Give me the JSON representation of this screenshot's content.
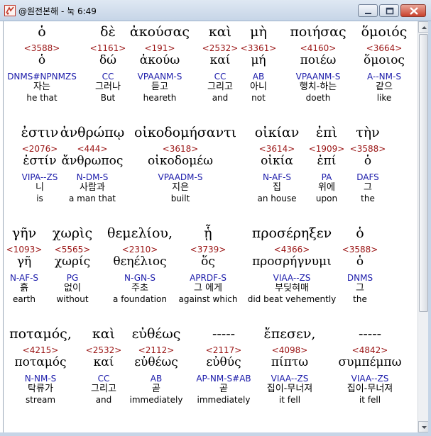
{
  "window": {
    "title": "@원전본해 - 눅 6:49"
  },
  "icons": {
    "app": "app-icon",
    "minimize": "minimize-icon",
    "maximize": "maximize-icon",
    "close": "close-icon"
  },
  "rows": [
    [
      {
        "greek": "ὁ",
        "strong": "<3588>",
        "lemma": "ὁ",
        "parse": "DNMS#NPNMZS",
        "korean": "자는",
        "english": "he that"
      },
      {
        "greek": "δὲ",
        "strong": "<1161>",
        "lemma": "δώ",
        "parse": "CC",
        "korean": "그러나",
        "english": "But"
      },
      {
        "greek": "ἀκούσας",
        "strong": "<191>",
        "lemma": "ἀκούω",
        "parse": "VPAANM-S",
        "korean": "듣고",
        "english": "heareth"
      },
      {
        "greek": "καὶ",
        "strong": "<2532>",
        "lemma": "καί",
        "parse": "CC",
        "korean": "그리고",
        "english": "and"
      },
      {
        "greek": "μὴ",
        "strong": "<3361>",
        "lemma": "μή",
        "parse": "AB",
        "korean": "아니",
        "english": "not"
      },
      {
        "greek": "ποιήσας",
        "strong": "<4160>",
        "lemma": "ποιέω",
        "parse": "VPAANM-S",
        "korean": "행치-하는",
        "english": "doeth"
      },
      {
        "greek": "ὅμοιός",
        "strong": "<3664>",
        "lemma": "ὅμοιος",
        "parse": "A--NM-S",
        "korean": "같으",
        "english": "like"
      }
    ],
    [
      {
        "greek": "ἐστιν",
        "strong": "<2076>",
        "lemma": "ἐστίν",
        "parse": "VIPA--ZS",
        "korean": "니",
        "english": "is"
      },
      {
        "greek": "ἀνθρώπῳ",
        "strong": "<444>",
        "lemma": "ἄνθρωπος",
        "parse": "N-DM-S",
        "korean": "사람과",
        "english": "a man that"
      },
      {
        "greek": "οἰκοδομήσαντι",
        "strong": "<3618>",
        "lemma": "οἰκοδομέω",
        "parse": "VPAADM-S",
        "korean": "지은",
        "english": "built"
      },
      {
        "greek": "οἰκίαν",
        "strong": "<3614>",
        "lemma": "οἰκία",
        "parse": "N-AF-S",
        "korean": "집",
        "english": "an house"
      },
      {
        "greek": "ἐπὶ",
        "strong": "<1909>",
        "lemma": "ἐπί",
        "parse": "PA",
        "korean": "위에",
        "english": "upon"
      },
      {
        "greek": "τὴν",
        "strong": "<3588>",
        "lemma": "ὁ",
        "parse": "DAFS",
        "korean": "그",
        "english": "the"
      }
    ],
    [
      {
        "greek": "γῆν",
        "strong": "<1093>",
        "lemma": "γῆ",
        "parse": "N-AF-S",
        "korean": "흙",
        "english": "earth"
      },
      {
        "greek": "χωρὶς",
        "strong": "<5565>",
        "lemma": "χωρίς",
        "parse": "PG",
        "korean": "없이",
        "english": "without"
      },
      {
        "greek": "θεμελίου,",
        "strong": "<2310>",
        "lemma": "θεηέλιος",
        "parse": "N-GN-S",
        "korean": "주초",
        "english": "a foundation"
      },
      {
        "greek": "ᾗ",
        "strong": "<3739>",
        "lemma": "ὅς",
        "parse": "APRDF-S",
        "korean": "그 에게",
        "english": "against which"
      },
      {
        "greek": "προσέρηξεν",
        "strong": "<4366>",
        "lemma": "προσρήγνυμι",
        "parse": "VIAA--ZS",
        "korean": "부딪혀매",
        "english": "did beat vehemently"
      },
      {
        "greek": "ὁ",
        "strong": "<3588>",
        "lemma": "ὁ",
        "parse": "DNMS",
        "korean": "그",
        "english": "the"
      }
    ],
    [
      {
        "greek": "ποταμός,",
        "strong": "<4215>",
        "lemma": "ποταμός",
        "parse": "N-NM-S",
        "korean": "탁류가",
        "english": "stream"
      },
      {
        "greek": "καὶ",
        "strong": "<2532>",
        "lemma": "καί",
        "parse": "CC",
        "korean": "그리고",
        "english": "and"
      },
      {
        "greek": "εὐθέως",
        "strong": "<2112>",
        "lemma": "εὐθέως",
        "parse": "AB",
        "korean": "곧",
        "english": "immediately"
      },
      {
        "greek": "-----",
        "strong": "<2117>",
        "lemma": "εὐθύς",
        "parse": "AP-NM-S#AB",
        "korean": "곧",
        "english": "immediately"
      },
      {
        "greek": "ἔπεσεν,",
        "strong": "<4098>",
        "lemma": "πίπτω",
        "parse": "VIAA--ZS",
        "korean": "집이-무너져",
        "english": "it fell"
      },
      {
        "greek": "-----",
        "strong": "<4842>",
        "lemma": "συμπέμπω",
        "parse": "VIAA--ZS",
        "korean": "집이-무너져",
        "english": "it fell"
      }
    ]
  ]
}
